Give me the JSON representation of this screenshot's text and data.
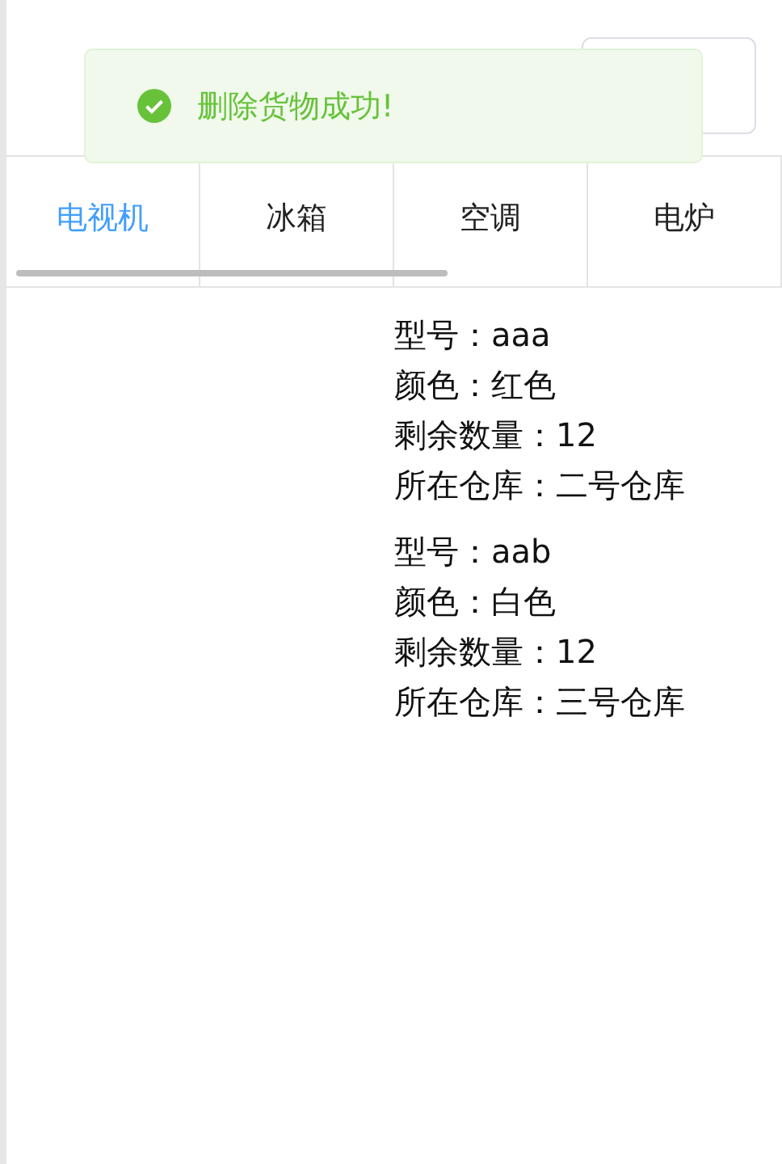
{
  "toast": {
    "kind": "success",
    "message": "删除货物成功!"
  },
  "tabs": [
    {
      "label": "电视机",
      "selected": true
    },
    {
      "label": "冰箱",
      "selected": false
    },
    {
      "label": "空调",
      "selected": false
    },
    {
      "label": "电炉",
      "selected": false
    }
  ],
  "goods": [
    {
      "lines": [
        "型号：aaa",
        "颜色：红色",
        "剩余数量：12",
        "所在仓库：二号仓库"
      ]
    },
    {
      "lines": [
        "型号：aab",
        "颜色：白色",
        "剩余数量：12",
        "所在仓库：三号仓库"
      ]
    }
  ]
}
